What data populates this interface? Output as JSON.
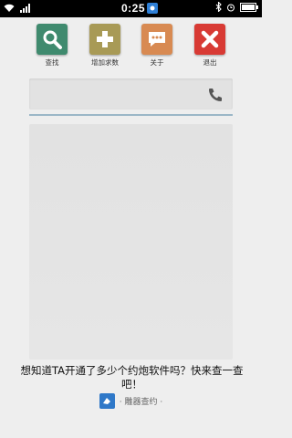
{
  "status_bar": {
    "time": "0:25"
  },
  "toolbar": {
    "items": [
      {
        "label": "查找",
        "icon": "search-icon",
        "color": "#3f8a6e"
      },
      {
        "label": "增加求数",
        "icon": "plus-icon",
        "color": "#a89a56"
      },
      {
        "label": "关于",
        "icon": "message-icon",
        "color": "#d88a52"
      },
      {
        "label": "退出",
        "icon": "close-icon",
        "color": "#d83a34"
      }
    ]
  },
  "search": {
    "value": "",
    "placeholder": ""
  },
  "promo": {
    "text": "想知道TA开通了多少个约炮软件吗？快来查一查吧！"
  },
  "footer": {
    "text": "· 雕器查约 ·"
  }
}
